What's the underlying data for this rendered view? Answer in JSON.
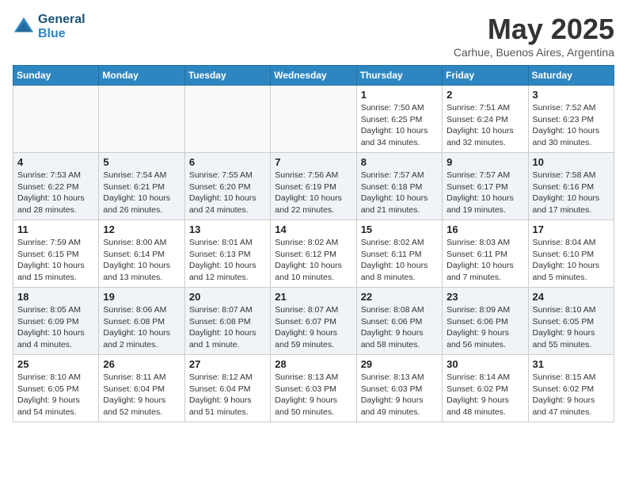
{
  "header": {
    "logo_line1": "General",
    "logo_line2": "Blue",
    "month": "May 2025",
    "location": "Carhue, Buenos Aires, Argentina"
  },
  "weekdays": [
    "Sunday",
    "Monday",
    "Tuesday",
    "Wednesday",
    "Thursday",
    "Friday",
    "Saturday"
  ],
  "weeks": [
    [
      {
        "day": "",
        "info": ""
      },
      {
        "day": "",
        "info": ""
      },
      {
        "day": "",
        "info": ""
      },
      {
        "day": "",
        "info": ""
      },
      {
        "day": "1",
        "info": "Sunrise: 7:50 AM\nSunset: 6:25 PM\nDaylight: 10 hours\nand 34 minutes."
      },
      {
        "day": "2",
        "info": "Sunrise: 7:51 AM\nSunset: 6:24 PM\nDaylight: 10 hours\nand 32 minutes."
      },
      {
        "day": "3",
        "info": "Sunrise: 7:52 AM\nSunset: 6:23 PM\nDaylight: 10 hours\nand 30 minutes."
      }
    ],
    [
      {
        "day": "4",
        "info": "Sunrise: 7:53 AM\nSunset: 6:22 PM\nDaylight: 10 hours\nand 28 minutes."
      },
      {
        "day": "5",
        "info": "Sunrise: 7:54 AM\nSunset: 6:21 PM\nDaylight: 10 hours\nand 26 minutes."
      },
      {
        "day": "6",
        "info": "Sunrise: 7:55 AM\nSunset: 6:20 PM\nDaylight: 10 hours\nand 24 minutes."
      },
      {
        "day": "7",
        "info": "Sunrise: 7:56 AM\nSunset: 6:19 PM\nDaylight: 10 hours\nand 22 minutes."
      },
      {
        "day": "8",
        "info": "Sunrise: 7:57 AM\nSunset: 6:18 PM\nDaylight: 10 hours\nand 21 minutes."
      },
      {
        "day": "9",
        "info": "Sunrise: 7:57 AM\nSunset: 6:17 PM\nDaylight: 10 hours\nand 19 minutes."
      },
      {
        "day": "10",
        "info": "Sunrise: 7:58 AM\nSunset: 6:16 PM\nDaylight: 10 hours\nand 17 minutes."
      }
    ],
    [
      {
        "day": "11",
        "info": "Sunrise: 7:59 AM\nSunset: 6:15 PM\nDaylight: 10 hours\nand 15 minutes."
      },
      {
        "day": "12",
        "info": "Sunrise: 8:00 AM\nSunset: 6:14 PM\nDaylight: 10 hours\nand 13 minutes."
      },
      {
        "day": "13",
        "info": "Sunrise: 8:01 AM\nSunset: 6:13 PM\nDaylight: 10 hours\nand 12 minutes."
      },
      {
        "day": "14",
        "info": "Sunrise: 8:02 AM\nSunset: 6:12 PM\nDaylight: 10 hours\nand 10 minutes."
      },
      {
        "day": "15",
        "info": "Sunrise: 8:02 AM\nSunset: 6:11 PM\nDaylight: 10 hours\nand 8 minutes."
      },
      {
        "day": "16",
        "info": "Sunrise: 8:03 AM\nSunset: 6:11 PM\nDaylight: 10 hours\nand 7 minutes."
      },
      {
        "day": "17",
        "info": "Sunrise: 8:04 AM\nSunset: 6:10 PM\nDaylight: 10 hours\nand 5 minutes."
      }
    ],
    [
      {
        "day": "18",
        "info": "Sunrise: 8:05 AM\nSunset: 6:09 PM\nDaylight: 10 hours\nand 4 minutes."
      },
      {
        "day": "19",
        "info": "Sunrise: 8:06 AM\nSunset: 6:08 PM\nDaylight: 10 hours\nand 2 minutes."
      },
      {
        "day": "20",
        "info": "Sunrise: 8:07 AM\nSunset: 6:08 PM\nDaylight: 10 hours\nand 1 minute."
      },
      {
        "day": "21",
        "info": "Sunrise: 8:07 AM\nSunset: 6:07 PM\nDaylight: 9 hours\nand 59 minutes."
      },
      {
        "day": "22",
        "info": "Sunrise: 8:08 AM\nSunset: 6:06 PM\nDaylight: 9 hours\nand 58 minutes."
      },
      {
        "day": "23",
        "info": "Sunrise: 8:09 AM\nSunset: 6:06 PM\nDaylight: 9 hours\nand 56 minutes."
      },
      {
        "day": "24",
        "info": "Sunrise: 8:10 AM\nSunset: 6:05 PM\nDaylight: 9 hours\nand 55 minutes."
      }
    ],
    [
      {
        "day": "25",
        "info": "Sunrise: 8:10 AM\nSunset: 6:05 PM\nDaylight: 9 hours\nand 54 minutes."
      },
      {
        "day": "26",
        "info": "Sunrise: 8:11 AM\nSunset: 6:04 PM\nDaylight: 9 hours\nand 52 minutes."
      },
      {
        "day": "27",
        "info": "Sunrise: 8:12 AM\nSunset: 6:04 PM\nDaylight: 9 hours\nand 51 minutes."
      },
      {
        "day": "28",
        "info": "Sunrise: 8:13 AM\nSunset: 6:03 PM\nDaylight: 9 hours\nand 50 minutes."
      },
      {
        "day": "29",
        "info": "Sunrise: 8:13 AM\nSunset: 6:03 PM\nDaylight: 9 hours\nand 49 minutes."
      },
      {
        "day": "30",
        "info": "Sunrise: 8:14 AM\nSunset: 6:02 PM\nDaylight: 9 hours\nand 48 minutes."
      },
      {
        "day": "31",
        "info": "Sunrise: 8:15 AM\nSunset: 6:02 PM\nDaylight: 9 hours\nand 47 minutes."
      }
    ]
  ]
}
